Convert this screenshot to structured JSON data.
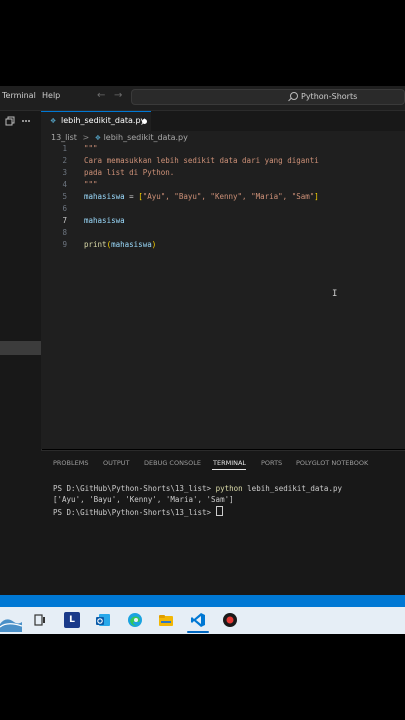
{
  "titlebar": {
    "menu": [
      "Terminal",
      "Help"
    ],
    "search_text": "Python-Shorts"
  },
  "tab": {
    "label": "lebih_sedikit_data.py",
    "icon": "python-file-icon",
    "modified": true
  },
  "breadcrumb": {
    "folder": "13_list",
    "sep": ">",
    "file": "lebih_sedikit_data.py"
  },
  "editor": {
    "line_numbers": [
      "1",
      "2",
      "3",
      "4",
      "5",
      "6",
      "7",
      "8",
      "9"
    ],
    "active_line": "7",
    "code": {
      "l1": "\"\"\"",
      "l2": "Cara memasukkan lebih sedikit data dari yang diganti",
      "l3": "pada list di Python.",
      "l4": "\"\"\"",
      "l5_var": "mahasiswa",
      "l5_eq": " = ",
      "l5_open": "[",
      "l5_items": "\"Ayu\", \"Bayu\", \"Kenny\", \"Maria\", \"Sam\"",
      "l5_close": "]",
      "l7": "mahasiswa",
      "l9_fn": "print",
      "l9_open": "(",
      "l9_arg": "mahasiswa",
      "l9_close": ")"
    }
  },
  "panel": {
    "tabs": [
      "PROBLEMS",
      "OUTPUT",
      "DEBUG CONSOLE",
      "TERMINAL",
      "PORTS",
      "POLYGLOT NOTEBOOK"
    ],
    "active_tab": "TERMINAL",
    "terminal": {
      "prompt1": "PS D:\\GitHub\\Python-Shorts\\13_list> ",
      "cmd1": "python",
      "args1": " lebih_sedikit_data.py",
      "output": "['Ayu', 'Bayu', 'Kenny', 'Maria', 'Sam']",
      "prompt2": "PS D:\\GitHub\\Python-Shorts\\13_list> "
    }
  },
  "taskbar": {
    "letter_icon": "L",
    "icons": [
      "task-view-icon",
      "launcher-l-icon",
      "outlook-icon",
      "edge-icon",
      "file-explorer-icon",
      "vscode-icon",
      "record-app-icon"
    ]
  },
  "colors": {
    "accent": "#0078d4",
    "editor_bg": "#1f1f1f",
    "string": "#ce9178",
    "variable": "#9cdcfe",
    "function": "#dcdcaa"
  }
}
